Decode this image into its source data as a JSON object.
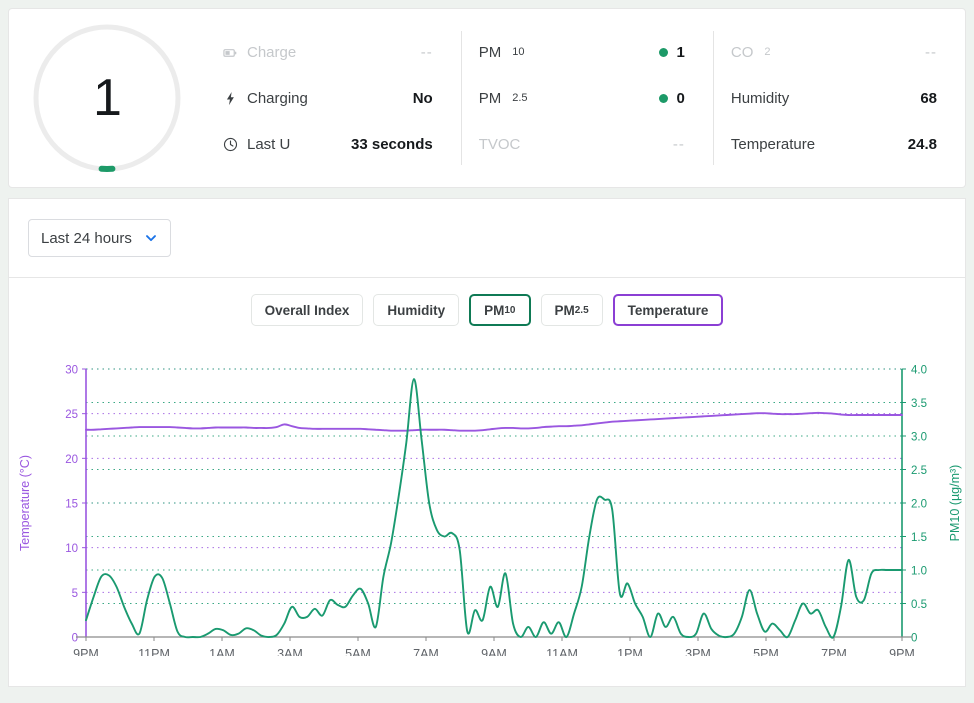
{
  "colors": {
    "pm10": "#1a9a70",
    "temperature": "#9a57e0",
    "axis_temp": "#9a57e0",
    "axis_pm": "#1a9a70",
    "dot_green": "#1d9a68",
    "accent_blue": "#1a73e8",
    "muted": "#c5c8cb"
  },
  "summary": {
    "gauge": {
      "value": "1",
      "aria_label": "overall-index"
    },
    "column_a": [
      {
        "icon": "battery-icon",
        "label": "Charge",
        "value": "--",
        "muted": true,
        "dot": false
      },
      {
        "icon": "bolt-icon",
        "label": "Charging",
        "value": "No",
        "muted": false,
        "dot": false
      },
      {
        "icon": "clock-icon",
        "label": "Last U",
        "value": "33 seconds",
        "muted": false,
        "dot": false
      }
    ],
    "column_b": [
      {
        "icon": "",
        "label": "PM",
        "sub": "10",
        "value": "1",
        "muted": false,
        "dot": true
      },
      {
        "icon": "",
        "label": "PM",
        "sub": "2.5",
        "value": "0",
        "muted": false,
        "dot": true
      },
      {
        "icon": "",
        "label": "TVOC",
        "sub": "",
        "value": "--",
        "muted": true,
        "dot": false
      }
    ],
    "column_c": [
      {
        "icon": "",
        "label": "CO",
        "sub": "2",
        "value": "--",
        "muted": true,
        "dot": false
      },
      {
        "icon": "",
        "label": "Humidity",
        "sub": "",
        "value": "68",
        "muted": false,
        "dot": false
      },
      {
        "icon": "",
        "label": "Temperature",
        "sub": "",
        "value": "24.8",
        "muted": false,
        "dot": false
      }
    ]
  },
  "range_selector": {
    "selected": "Last 24 hours",
    "icon": "chevron-down-icon"
  },
  "tabs": [
    {
      "label": "Overall Index",
      "sub": "",
      "state": "inactive"
    },
    {
      "label": "Humidity",
      "sub": "",
      "state": "inactive"
    },
    {
      "label": "PM",
      "sub": "10",
      "state": "active-pm"
    },
    {
      "label": "PM",
      "sub": "2.5",
      "state": "inactive"
    },
    {
      "label": "Temperature",
      "sub": "",
      "state": "active-temp"
    }
  ],
  "chart_data": {
    "type": "line",
    "title": "",
    "xlabel": "",
    "grid": true,
    "legend": "none",
    "x_ticks": [
      "9PM",
      "11PM",
      "1AM",
      "3AM",
      "5AM",
      "7AM",
      "9AM",
      "11AM",
      "1PM",
      "3PM",
      "5PM",
      "7PM",
      "9PM"
    ],
    "axes": {
      "left": {
        "label": "Temperature (°C)",
        "color": "#9a57e0",
        "ticks": [
          "0",
          "5",
          "10",
          "15",
          "20",
          "25",
          "30"
        ],
        "range": [
          0,
          30
        ]
      },
      "right": {
        "label": "PM10 (µg/m³)",
        "color": "#1a9a70",
        "ticks": [
          "0",
          "0.5",
          "1.0",
          "1.5",
          "2.0",
          "2.5",
          "3.0",
          "3.5",
          "4.0"
        ],
        "range": [
          0,
          4
        ]
      }
    },
    "series": [
      {
        "name": "Temperature",
        "axis": "left",
        "color": "#9a57e0",
        "unit": "°C",
        "values": [
          23.2,
          23.2,
          23.25,
          23.3,
          23.35,
          23.4,
          23.45,
          23.5,
          23.5,
          23.5,
          23.5,
          23.5,
          23.45,
          23.4,
          23.35,
          23.35,
          23.4,
          23.45,
          23.45,
          23.45,
          23.45,
          23.45,
          23.4,
          23.4,
          23.4,
          23.5,
          23.8,
          23.6,
          23.4,
          23.35,
          23.3,
          23.3,
          23.3,
          23.3,
          23.3,
          23.3,
          23.3,
          23.25,
          23.2,
          23.15,
          23.1,
          23.1,
          23.1,
          23.15,
          23.2,
          23.2,
          23.2,
          23.2,
          23.15,
          23.1,
          23.1,
          23.1,
          23.15,
          23.25,
          23.35,
          23.4,
          23.4,
          23.35,
          23.35,
          23.4,
          23.5,
          23.55,
          23.6,
          23.6,
          23.65,
          23.7,
          23.8,
          23.9,
          24.0,
          24.1,
          24.15,
          24.2,
          24.25,
          24.3,
          24.35,
          24.4,
          24.45,
          24.5,
          24.55,
          24.6,
          24.65,
          24.7,
          24.75,
          24.8,
          24.85,
          24.9,
          24.95,
          25.0,
          25.05,
          25.05,
          25.0,
          24.95,
          24.95,
          24.95,
          25.0,
          25.05,
          25.1,
          25.05,
          25.0,
          24.9,
          24.85,
          24.85,
          24.85,
          24.85,
          24.85,
          24.85,
          24.85,
          24.85
        ]
      },
      {
        "name": "PM10",
        "axis": "right",
        "color": "#1a9a70",
        "unit": "µg/m³",
        "values": [
          0.25,
          0.6,
          0.9,
          0.92,
          0.75,
          0.45,
          0.2,
          0.05,
          0.55,
          0.9,
          0.88,
          0.5,
          0.08,
          0.0,
          0.0,
          0.0,
          0.05,
          0.12,
          0.1,
          0.03,
          0.05,
          0.13,
          0.1,
          0.02,
          0.0,
          0.03,
          0.2,
          0.45,
          0.3,
          0.3,
          0.42,
          0.32,
          0.55,
          0.48,
          0.45,
          0.62,
          0.72,
          0.5,
          0.15,
          0.9,
          1.4,
          2.1,
          2.9,
          3.85,
          2.95,
          2.0,
          1.6,
          1.5,
          1.55,
          1.3,
          0.08,
          0.4,
          0.25,
          0.75,
          0.45,
          0.95,
          0.2,
          0.0,
          0.15,
          0.0,
          0.22,
          0.05,
          0.22,
          0.0,
          0.35,
          0.75,
          1.5,
          2.05,
          2.05,
          1.9,
          0.65,
          0.8,
          0.5,
          0.3,
          0.0,
          0.35,
          0.15,
          0.3,
          0.05,
          0.0,
          0.05,
          0.35,
          0.12,
          0.02,
          0.0,
          0.05,
          0.3,
          0.7,
          0.35,
          0.08,
          0.2,
          0.1,
          0.0,
          0.25,
          0.5,
          0.35,
          0.4,
          0.15,
          0.0,
          0.45,
          1.15,
          0.6,
          0.55,
          0.95,
          1.0,
          1.0,
          1.0,
          1.0
        ]
      }
    ]
  }
}
